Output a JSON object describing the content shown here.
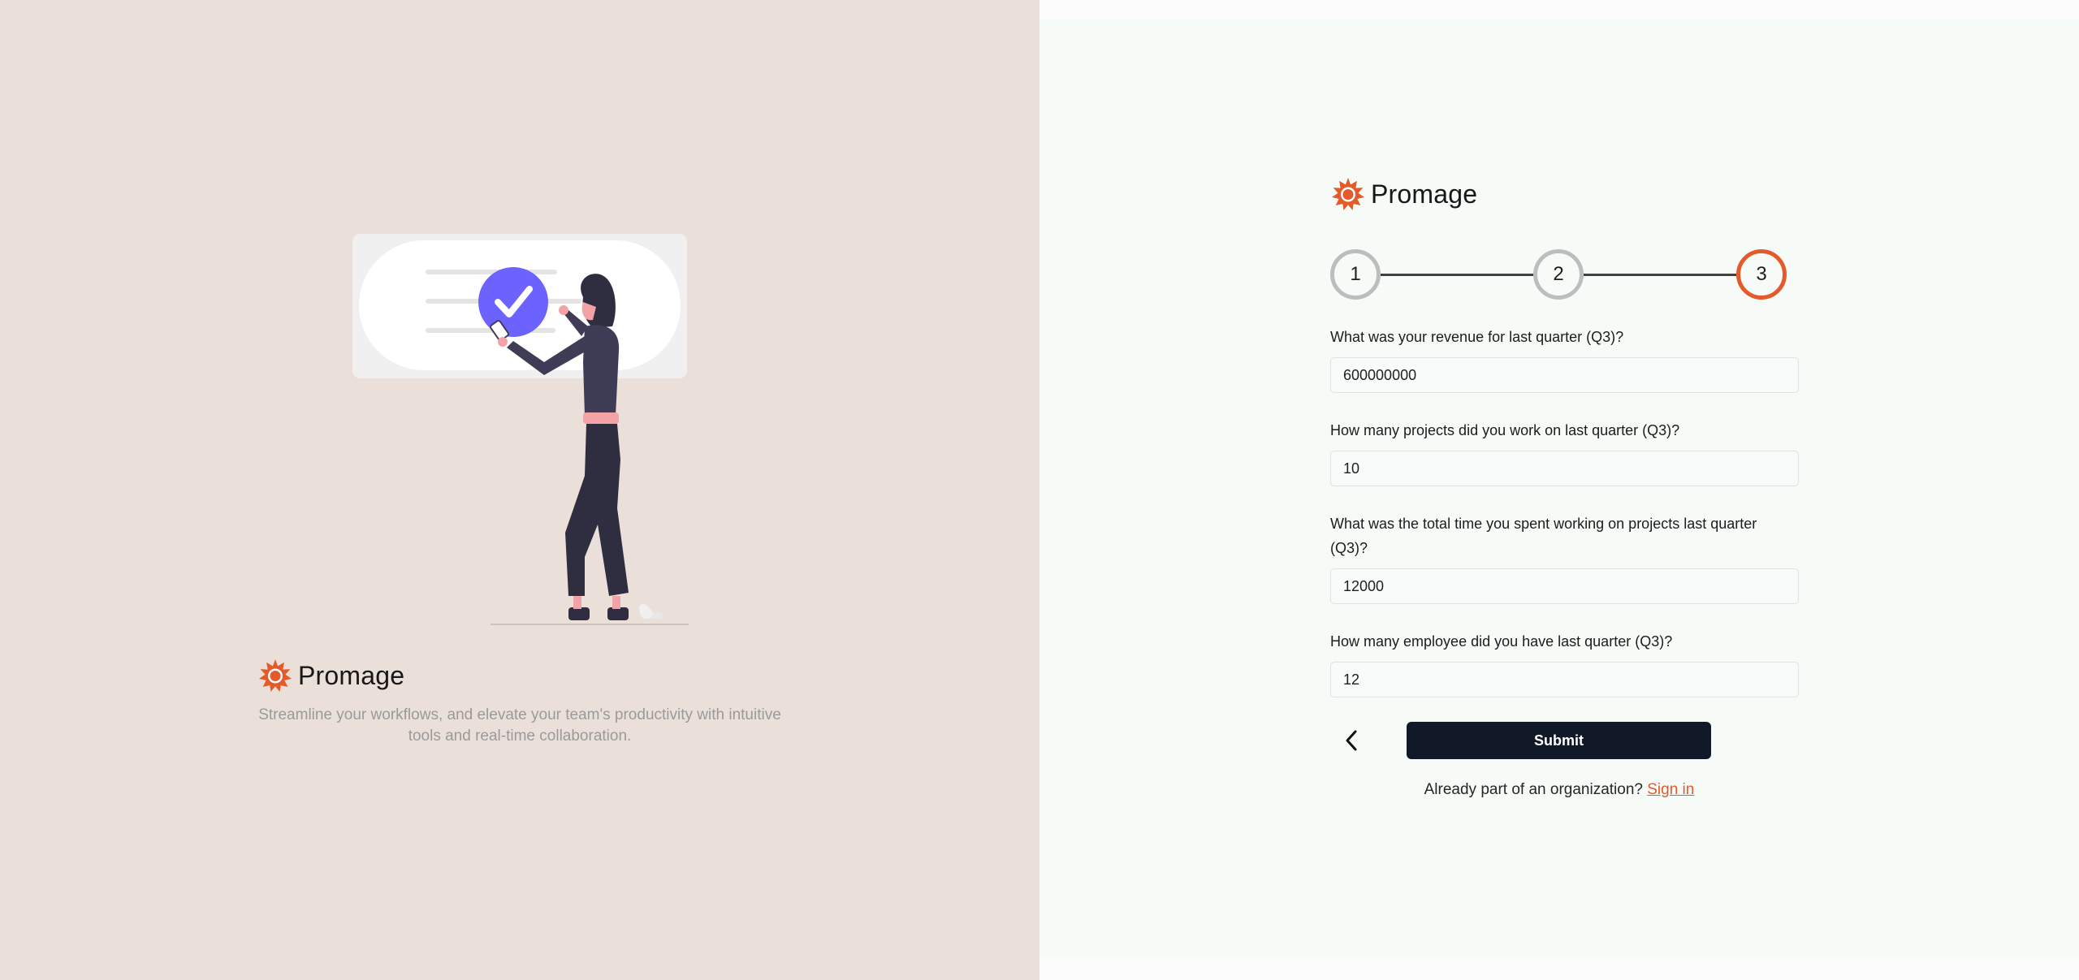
{
  "brand": {
    "name": "Promage",
    "accent_color": "#e35a2b",
    "logo_icon": "sunburst-logo-icon"
  },
  "hero": {
    "tagline": "Streamline your workflows, and elevate your team's productivity with intuitive tools and real-time collaboration.",
    "illustration": "woman-checking-task-illustration",
    "illustration_accent": "#6c63ff"
  },
  "stepper": {
    "steps": [
      {
        "label": "1",
        "state": "completed"
      },
      {
        "label": "2",
        "state": "completed"
      },
      {
        "label": "3",
        "state": "active"
      }
    ]
  },
  "form": {
    "fields": [
      {
        "label": "What was your revenue for last quarter (Q3)?",
        "value": "600000000"
      },
      {
        "label": "How many projects did you work on last quarter (Q3)?",
        "value": "10"
      },
      {
        "label": "What was the total time you spent working on projects last quarter (Q3)?",
        "value": "12000"
      },
      {
        "label": "How many employee did you have last quarter (Q3)?",
        "value": "12"
      }
    ],
    "back_icon": "chevron-left-icon",
    "submit_label": "Submit"
  },
  "signin": {
    "prompt": "Already part of an organization?",
    "link_label": "Sign in"
  }
}
